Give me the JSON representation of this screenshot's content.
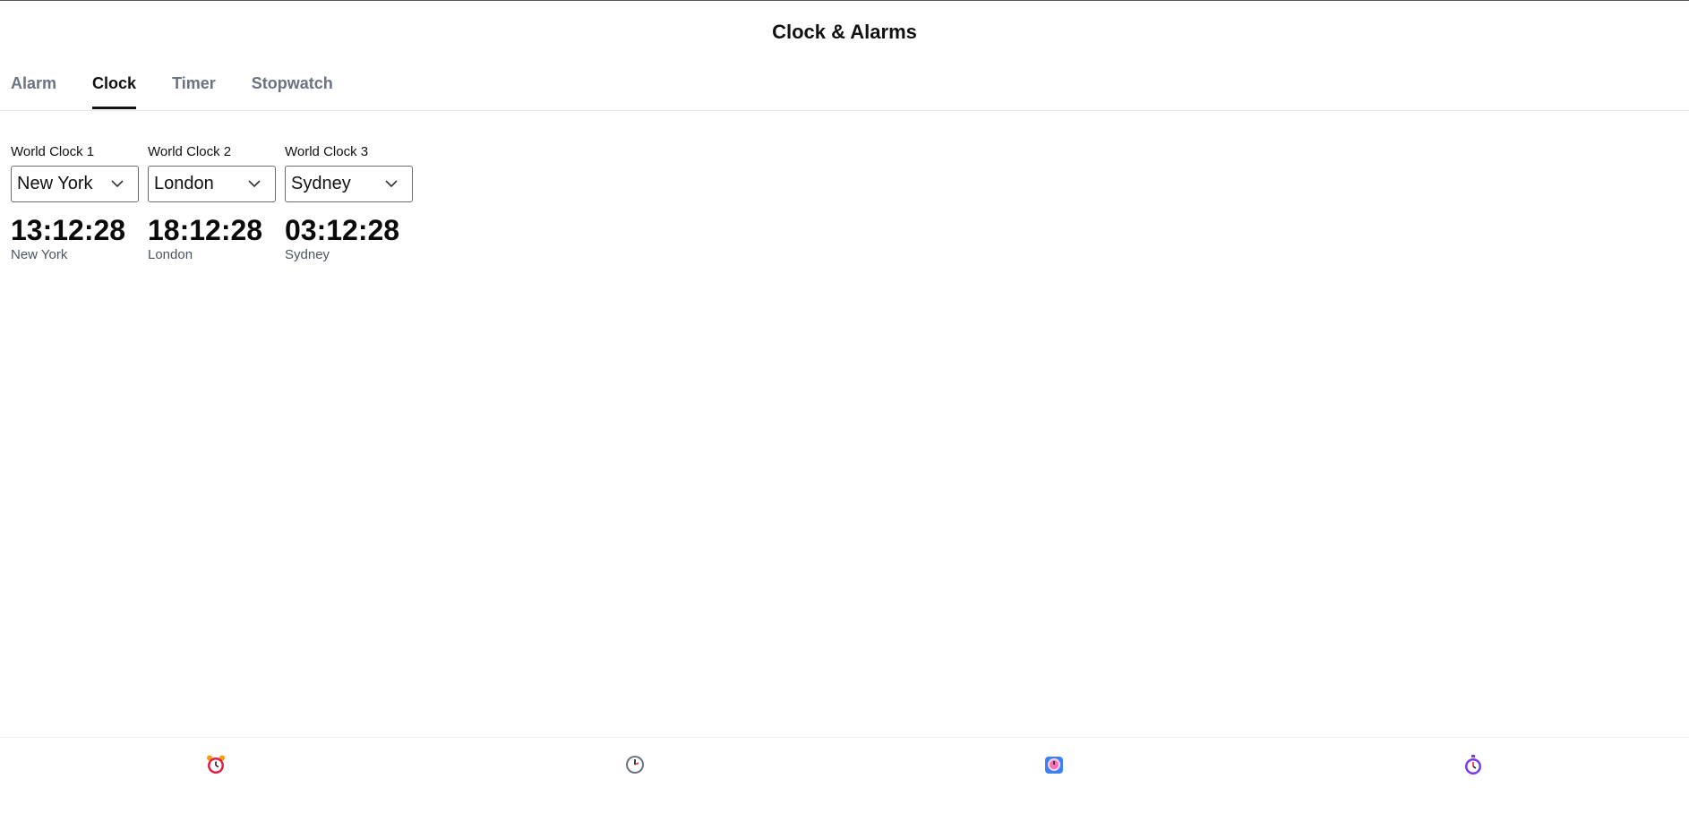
{
  "app": {
    "title": "Clock & Alarms"
  },
  "tabs": [
    {
      "label": "Alarm",
      "active": false
    },
    {
      "label": "Clock",
      "active": true
    },
    {
      "label": "Timer",
      "active": false
    },
    {
      "label": "Stopwatch",
      "active": false
    }
  ],
  "clocks": [
    {
      "label": "World Clock 1",
      "selected": "New York",
      "time": "13:12:28",
      "city": "New York"
    },
    {
      "label": "World Clock 2",
      "selected": "London",
      "time": "18:12:28",
      "city": "London"
    },
    {
      "label": "World Clock 3",
      "selected": "Sydney",
      "time": "03:12:28",
      "city": "Sydney"
    }
  ],
  "bottom_nav": [
    {
      "icon": "alarm-clock-icon",
      "color": "#e11d48"
    },
    {
      "icon": "clock-icon",
      "color": "#6b7280"
    },
    {
      "icon": "timer-icon",
      "color": "#3b82f6"
    },
    {
      "icon": "stopwatch-icon",
      "color": "#7c3aed"
    }
  ]
}
